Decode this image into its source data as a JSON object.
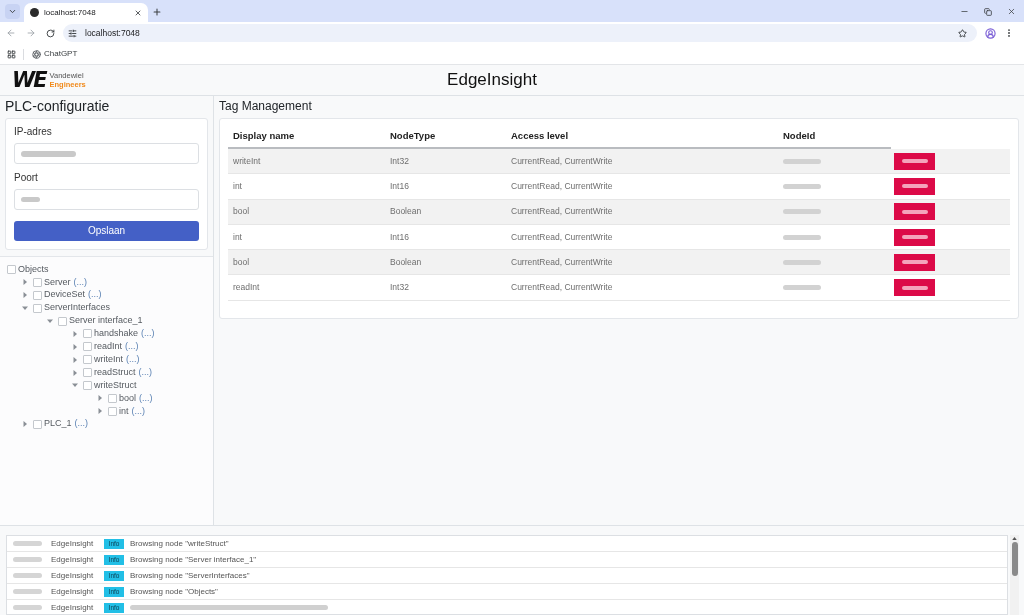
{
  "browser": {
    "tab_title": "localhost:7048",
    "url": "localhost:7048",
    "bookmarks": [
      "ChatGPT"
    ]
  },
  "header": {
    "logo": {
      "mark": "WE",
      "line_1": "Vandewiel",
      "line_2": "Engineers"
    },
    "title": "EdgeInsight"
  },
  "plc_config": {
    "title": "PLC-configuratie",
    "fields": [
      {
        "label": "IP-adres",
        "value": {
          "blurred": true
        }
      },
      {
        "label": "Poort",
        "value": {
          "blurred": true
        }
      }
    ],
    "save_button": "Opslaan"
  },
  "object_tree": [
    {
      "label": "Objects",
      "checked": false,
      "children": [
        {
          "label": "Server",
          "more": "(...)",
          "checked": false,
          "expanded": false
        },
        {
          "label": "DeviceSet",
          "more": "(...)",
          "checked": false,
          "expanded": false
        },
        {
          "label": "ServerInterfaces",
          "checked": false,
          "expanded": true,
          "children": [
            {
              "label": "Server interface_1",
              "checked": false,
              "expanded": true,
              "children": [
                {
                  "label": "handshake",
                  "more": "(...)",
                  "checked": false,
                  "expanded": false
                },
                {
                  "label": "readInt",
                  "more": "(...)",
                  "checked": false,
                  "expanded": false
                },
                {
                  "label": "writeInt",
                  "more": "(...)",
                  "checked": false,
                  "expanded": false
                },
                {
                  "label": "readStruct",
                  "more": "(...)",
                  "checked": false,
                  "expanded": false
                },
                {
                  "label": "writeStruct",
                  "checked": false,
                  "expanded": true,
                  "children": [
                    {
                      "label": "bool",
                      "more": "(...)",
                      "checked": false,
                      "expanded": false
                    },
                    {
                      "label": "int",
                      "more": "(...)",
                      "checked": false,
                      "expanded": false
                    }
                  ]
                }
              ]
            }
          ]
        },
        {
          "label": "PLC_1",
          "more": "(...)",
          "checked": false,
          "expanded": false
        }
      ]
    }
  ],
  "tag_management": {
    "title": "Tag Management",
    "columns": [
      "Display name",
      "NodeType",
      "Access level",
      "NodeId"
    ],
    "rows": [
      {
        "display_name": "writeInt",
        "node_type": "Int32",
        "access_level": "CurrentRead, CurrentWrite",
        "node_id": {
          "blurred": true
        },
        "action": {
          "blurred": true
        }
      },
      {
        "display_name": "int",
        "node_type": "Int16",
        "access_level": "CurrentRead, CurrentWrite",
        "node_id": {
          "blurred": true
        },
        "action": {
          "blurred": true
        }
      },
      {
        "display_name": "bool",
        "node_type": "Boolean",
        "access_level": "CurrentRead, CurrentWrite",
        "node_id": {
          "blurred": true
        },
        "action": {
          "blurred": true
        }
      },
      {
        "display_name": "int",
        "node_type": "Int16",
        "access_level": "CurrentRead, CurrentWrite",
        "node_id": {
          "blurred": true
        },
        "action": {
          "blurred": true
        }
      },
      {
        "display_name": "bool",
        "node_type": "Boolean",
        "access_level": "CurrentRead, CurrentWrite",
        "node_id": {
          "blurred": true
        },
        "action": {
          "blurred": true
        }
      },
      {
        "display_name": "readInt",
        "node_type": "Int32",
        "access_level": "CurrentRead, CurrentWrite",
        "node_id": {
          "blurred": true
        },
        "action": {
          "blurred": true
        }
      }
    ]
  },
  "log": {
    "entries": [
      {
        "time": {
          "blurred": true
        },
        "source": "EdgeInsight",
        "level": "Info",
        "message": "Browsing node \"writeStruct\""
      },
      {
        "time": {
          "blurred": true
        },
        "source": "EdgeInsight",
        "level": "Info",
        "message": "Browsing node \"Server interface_1\""
      },
      {
        "time": {
          "blurred": true
        },
        "source": "EdgeInsight",
        "level": "Info",
        "message": "Browsing node \"ServerInterfaces\""
      },
      {
        "time": {
          "blurred": true
        },
        "source": "EdgeInsight",
        "level": "Info",
        "message": "Browsing node \"Objects\""
      },
      {
        "time": {
          "blurred": true
        },
        "source": "EdgeInsight",
        "level": "Info",
        "message": {
          "blurred": true
        }
      }
    ]
  }
}
